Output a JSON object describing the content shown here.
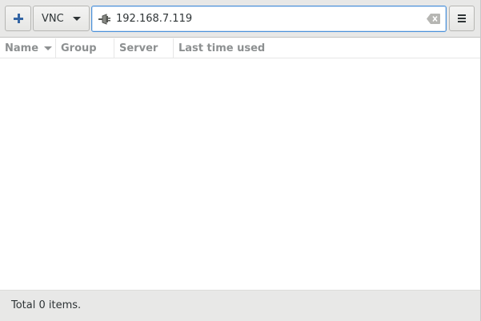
{
  "toolbar": {
    "add_button_icon": "plus-icon",
    "protocol_label": "VNC",
    "menu_button_icon": "hamburger-icon",
    "search": {
      "value": "192.168.7.119",
      "leading_icon": "connect-icon",
      "trailing_icon": "clear-icon"
    }
  },
  "list": {
    "columns": [
      {
        "label": "Name",
        "sorted": "descending"
      },
      {
        "label": "Group"
      },
      {
        "label": "Server"
      },
      {
        "label": "Last time used"
      }
    ],
    "rows": []
  },
  "status": {
    "text": "Total 0 items."
  },
  "colors": {
    "accent": "#3465a4",
    "focus_border": "#4a90d9",
    "toolbar_bg": "#e8e8e7",
    "header_text": "#8d9091"
  }
}
